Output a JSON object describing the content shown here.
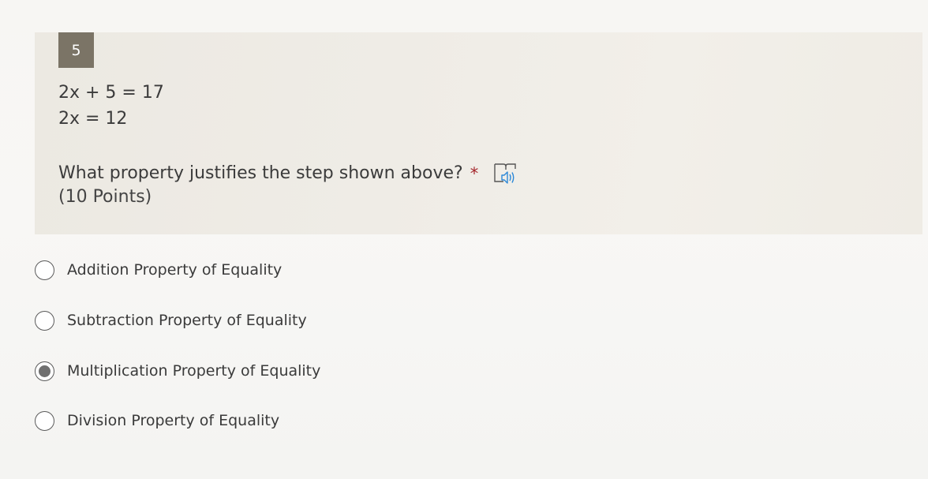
{
  "question": {
    "number": "5",
    "equation_lines": [
      "2x + 5 = 17",
      "2x = 12"
    ],
    "text": "What property justifies the step shown above?",
    "required_marker": "*",
    "points": "(10 Points)",
    "reader_icon": "immersive-reader-icon"
  },
  "options": [
    {
      "label": "Addition Property of Equality",
      "selected": false
    },
    {
      "label": "Subtraction Property of Equality",
      "selected": false
    },
    {
      "label": "Multiplication Property of Equality",
      "selected": true
    },
    {
      "label": "Division Property of Equality",
      "selected": false
    }
  ],
  "colors": {
    "number_badge": "#7b7466",
    "required_star": "#a4262c",
    "reader_icon_accent": "#2b88d8",
    "selected_radio": "#6f6f6f"
  }
}
